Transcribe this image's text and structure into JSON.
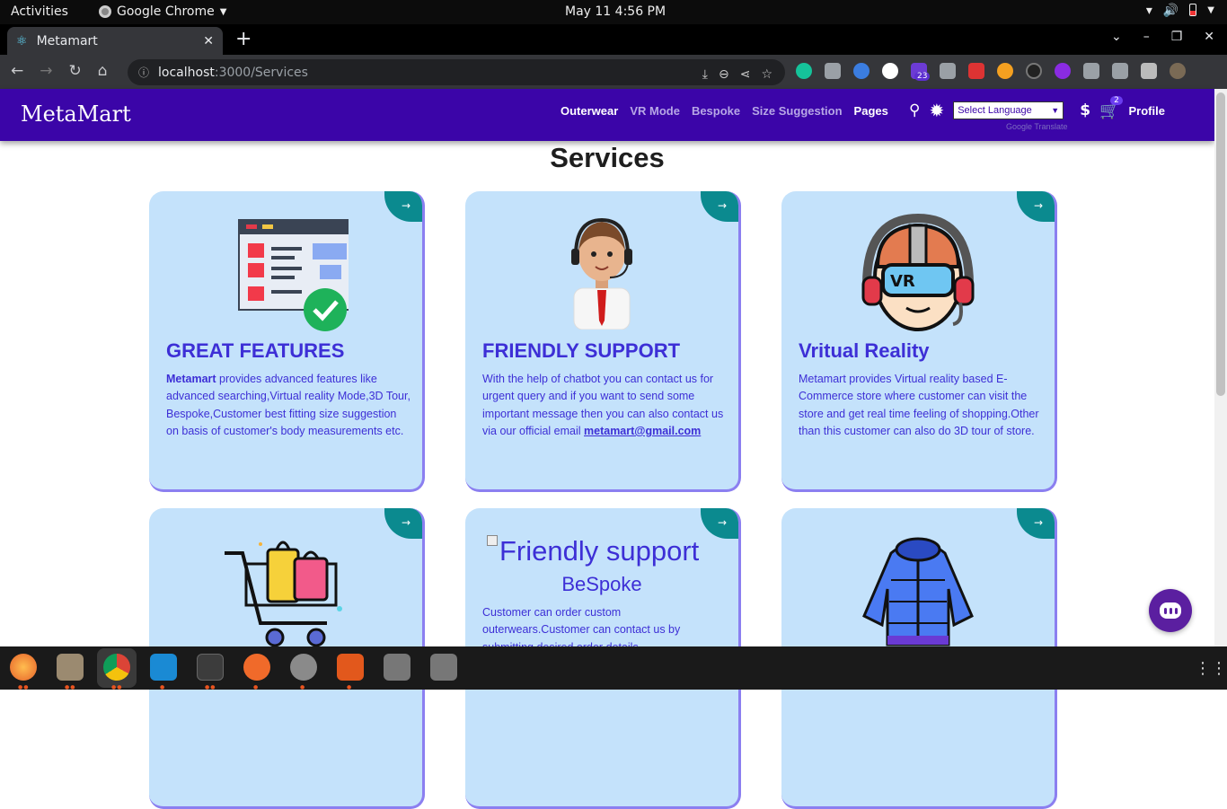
{
  "gnome": {
    "activities": "Activities",
    "app_name": "Google Chrome",
    "clock": "May 11  4:56 PM"
  },
  "browser": {
    "tab_title": "Metamart",
    "url_host": "localhost",
    "url_rest": ":3000/Services",
    "extension_badge": "23"
  },
  "site": {
    "brand": "MetaMart",
    "nav": {
      "outerwear": "Outerwear",
      "vr_mode": "VR Mode",
      "bespoke": "Bespoke",
      "size_suggestion": "Size Suggestion",
      "pages": "Pages"
    },
    "language_select": "Select Language",
    "google_translate": "Google Translate",
    "currency": "$",
    "cart_count": "2",
    "profile": "Profile"
  },
  "page": {
    "title": "Services",
    "card_arrow": "→",
    "cards": [
      {
        "title": "GREAT FEATURES",
        "bold_lead": "Metamart",
        "text": " provides advanced features like advanced searching,Virtual reality Mode,3D Tour, Bespoke,Customer best fitting size suggestion on basis of customer's body measurements etc."
      },
      {
        "title": "FRIENDLY SUPPORT",
        "text": "With the help of chatbot you can contact us for urgent query and if you want to send some important message then you can also contact us via our official email ",
        "email": "metamart@gmail.com"
      },
      {
        "title": "Vritual Reality",
        "text": "Metamart provides Virtual reality based E-Commerce store where customer can visit the store and get real time feeling of shopping.Other than this customer can also do 3D tour of store."
      },
      {
        "title": "",
        "text": ""
      },
      {
        "broken_alt": "Friendly support",
        "title": "BeSpoke",
        "text": "Customer can order custom outerwears.Customer can contact us by submitting desired order details"
      },
      {
        "title": "",
        "text": ""
      }
    ]
  },
  "colors": {
    "navbar": "#3b05a8",
    "card_bg": "#c4e2fb",
    "card_accent": "#0b8a8f",
    "card_text": "#3d2fd6"
  }
}
